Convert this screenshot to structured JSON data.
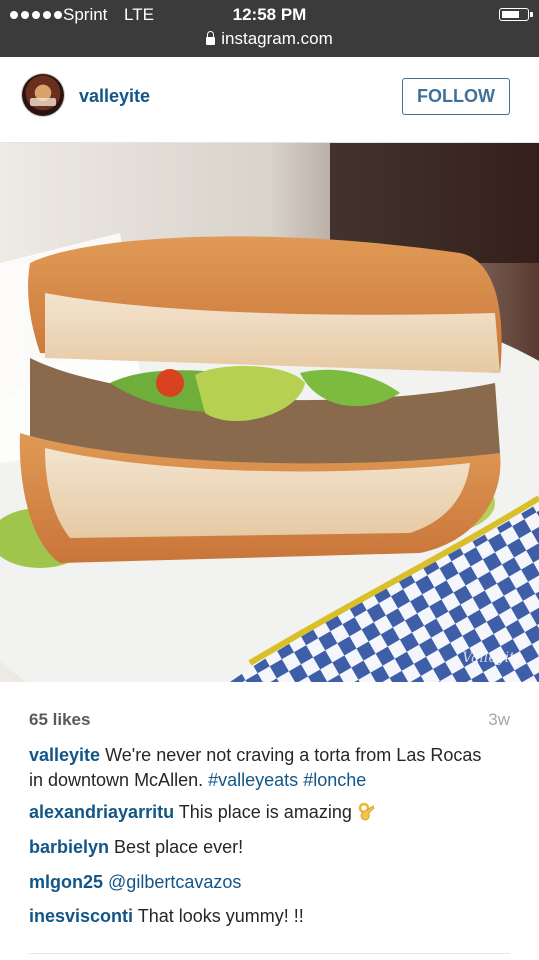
{
  "status_bar": {
    "carrier": "Sprint",
    "network": "LTE",
    "time": "12:58 PM",
    "url": "instagram.com"
  },
  "post": {
    "username": "valleyite",
    "follow_label": "FOLLOW",
    "watermark": "Valleyite",
    "likes": "65 likes",
    "age": "3w",
    "caption": {
      "user": "valleyite",
      "text": "We're never not craving a torta from Las Rocas in downtown McAllen.",
      "hashtags": [
        "#valleyeats",
        "#lonche"
      ]
    },
    "comments": [
      {
        "user": "alexandriayarritu",
        "text": "This place is amazing",
        "emoji": "ok-hand-icon"
      },
      {
        "user": "barbielyn",
        "text": "Best place ever!"
      },
      {
        "user": "mlgon25",
        "mention": "@gilbertcavazos"
      },
      {
        "user": "inesvisconti",
        "text": "That looks yummy! !!"
      }
    ]
  },
  "colors": {
    "status_bg": "#3b3b3b",
    "username_blue": "#125688",
    "follow_blue": "#3f729b",
    "muted": "#a5a7aa"
  }
}
